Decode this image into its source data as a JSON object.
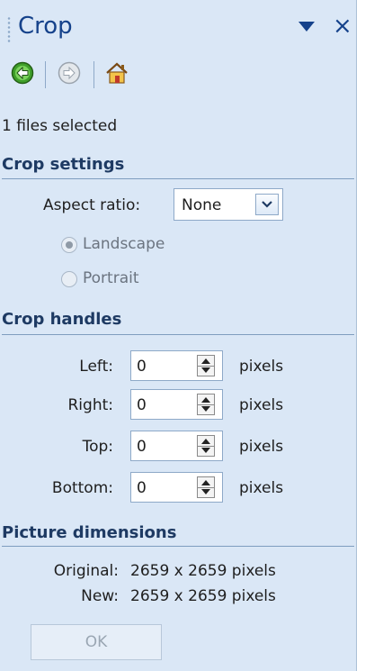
{
  "panel": {
    "title": "Crop"
  },
  "toolbar": {
    "back_icon": "back-arrow-icon",
    "forward_icon": "forward-arrow-icon",
    "home_icon": "home-icon"
  },
  "selection_status": "1 files selected",
  "crop_settings": {
    "heading": "Crop settings",
    "aspect_ratio_label": "Aspect ratio:",
    "aspect_ratio_value": "None",
    "orientation": [
      {
        "label": "Landscape",
        "selected": true,
        "enabled": false
      },
      {
        "label": "Portrait",
        "selected": false,
        "enabled": false
      }
    ]
  },
  "crop_handles": {
    "heading": "Crop handles",
    "rows": [
      {
        "label": "Left:",
        "value": "0",
        "unit": "pixels"
      },
      {
        "label": "Right:",
        "value": "0",
        "unit": "pixels"
      },
      {
        "label": "Top:",
        "value": "0",
        "unit": "pixels"
      },
      {
        "label": "Bottom:",
        "value": "0",
        "unit": "pixels"
      }
    ]
  },
  "picture_dimensions": {
    "heading": "Picture dimensions",
    "original_label": "Original:",
    "original_value": "2659 x 2659 pixels",
    "new_label": "New:",
    "new_value": "2659 x 2659 pixels"
  },
  "ok_button": {
    "label": "OK",
    "enabled": false
  },
  "colors": {
    "pane_bg": "#dae7f6",
    "title": "#15428b",
    "section": "#1e3a63"
  }
}
